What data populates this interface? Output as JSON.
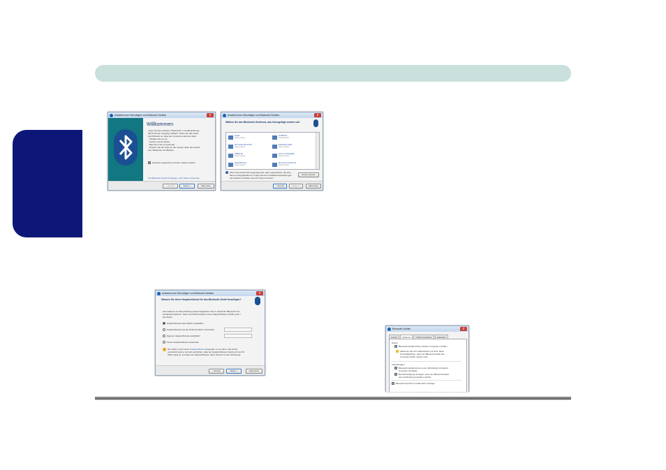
{
  "page": {
    "colors": {
      "header_bar": "#c9e0dc",
      "side_tab": "#0d1777",
      "footer_rule": "#7a7a7a"
    }
  },
  "dialog_welcome": {
    "title": "Assistent zum Hinzufügen von Bluetooth-Geräten",
    "heading": "Willkommen",
    "body_lines": [
      "Legen Sie den Assistent \"Bluetooth\" in Geräteanleitung,",
      "damit Sie den Vorgang finalisiert. Rufen Sie das Gerät",
      "einrichtbereit an, dass der Computer erkennen kann:",
      "- Schalten Sie es ein",
      "- Suchen erneut starten",
      "- Benennen Sie es (optional)",
      "- Drücken Sie die Taste an der unteren Seite des Geräts",
      "  (nur Tastaturen und Mäuse)"
    ],
    "checkbox_label": "Gerät ist eingerichtet und kann erkannt werden",
    "link": "Zur Bluetooth-Gerät hinzufügen, ohne Taste verwenden",
    "buttons": {
      "back": "< Zurück",
      "next": "Weiter >",
      "cancel": "Abbrechen"
    },
    "icon": "bluetooth-logo"
  },
  "dialog_select": {
    "title": "Assistent zum Hinzufügen von Bluetooth-Geräten",
    "heading": "Wählen Sie das Bluetooth-Gerät aus, das hinzugefügt werden soll.",
    "devices": [
      {
        "name": "Audio",
        "type": "Neues Gerät"
      },
      {
        "name": "JORDAN",
        "type": "Neues Gerät"
      },
      {
        "name": "00:1F:E2:55:A6:0F",
        "type": "Neues Gerät"
      },
      {
        "name": "ERIKDALAHE",
        "type": "Neues Gerät"
      },
      {
        "name": "PBBOTE",
        "type": "Neues Gerät"
      },
      {
        "name": "wbvs (77&&9)Wk",
        "type": "Neues Gerät"
      },
      {
        "name": "HENRIKSH1",
        "type": "Neues Gerät"
      },
      {
        "name": "00:11:E4:04:EA:03",
        "type": "Neues Gerät"
      }
    ],
    "info_lines": [
      "Wenn das Gerät nicht angezeigt wird, dann vergewissern Sie sich,",
      "dass es eingeschaltet ist. Folgen Sie den Installationsanweisungen",
      "des Geräts und klicken Sie auf \"Erneut suchen\"."
    ],
    "search_again": "Erneut suchen",
    "buttons": {
      "back": "< Zurück",
      "next": "Weiter >",
      "cancel": "Abbrechen"
    }
  },
  "dialog_passkey": {
    "title": "Assistent zum Hinzufügen von Bluetooth-Geräten",
    "heading": "Müssen Sie einen Hauptschlüssel für das Bluetooth-Gerät hinzufügen?",
    "intro_lines": [
      "Informationen zur Beschreibung dieser Pageführen Sie im Abschnitt \"Bluetooth\" der",
      "Geräteinformationen. Wenn die Dokumentation einen Hauptschlüssel enthält, dann verwenden",
      "Sie diesen."
    ],
    "options": [
      "Hauptschlüssel automatisch auswählen",
      "Hauptschlüssel aus der Dokumentation verwenden:",
      "Eigenen Hauptschlüssel auswählen:",
      "Keinen Hauptschlüssel verwenden"
    ],
    "warn_prefix": "Sie sollten immer einen",
    "warn_link": "Hauptschlüssel",
    "warn_lines": [
      "verwenden, es sei denn, das Gerät",
      "unterstützt keinen. Es wird empfohlen, dass der Hauptschlüssel zwischen 8 und 16",
      "Ziffern lang ist. Je länger der Hauptschlüssel, desto sicherer ist die Verbindung."
    ],
    "buttons": {
      "back": "< Zurück",
      "next": "Weiter >",
      "cancel": "Abbrechen"
    }
  },
  "dialog_settings": {
    "title": "Bluetooth-Geräte",
    "tabs": [
      "Geräte",
      "Optionen",
      "COM-Anschlüsse",
      "Hardware"
    ],
    "group_discovery": "Suche",
    "discovery_check": "Bluetooth-Geräte können diesen Computer ermitteln",
    "discovery_warn_lines": [
      "Aktivieren Sie zum Datenschutz nur dann diese",
      "Kontrollkästchen, wenn ein Bluetooth-Gerät den",
      "Computer finden müssen soll."
    ],
    "group_connections": "Verbindungen",
    "conn_check_1_lines": [
      "Bluetooth-Geräte können eine Verbindung mit diesem",
      "Computer herstellen"
    ],
    "conn_check_2_lines": [
      "Benachrichtigung anzeigen, wenn ein Bluetooth-Gerät",
      "eine Verbindung herstellen möchte"
    ],
    "tray_check": "Bluetooth-Symbol im Infobereich anzeigen"
  }
}
